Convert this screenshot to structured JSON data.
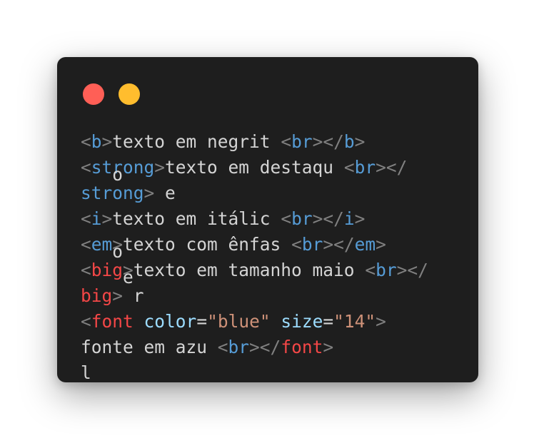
{
  "window": {
    "controls": [
      {
        "name": "close",
        "color": "#ff5f56"
      },
      {
        "name": "minimize",
        "color": "#ffbd2e"
      }
    ]
  },
  "theme": {
    "background": "#1e1e1e",
    "bracket": "#808080",
    "tag_blue": "#569cd6",
    "tag_red": "#f44747",
    "attr": "#9cdcfe",
    "string": "#ce9178",
    "text": "#d4d4d4"
  },
  "code_lines": [
    {
      "tokens": [
        {
          "t": "<",
          "k": "bracket"
        },
        {
          "t": "b",
          "k": "tag_blue"
        },
        {
          "t": ">",
          "k": "bracket"
        },
        {
          "t": "texto em negrit ",
          "k": "text"
        },
        {
          "t": "<",
          "k": "bracket"
        },
        {
          "t": "br",
          "k": "tag_blue"
        },
        {
          "t": "></",
          "k": "bracket"
        },
        {
          "t": "b",
          "k": "tag_blue"
        },
        {
          "t": ">",
          "k": "bracket"
        }
      ]
    },
    {
      "tokens": [
        {
          "t": "<",
          "k": "bracket"
        },
        {
          "t": "strong",
          "k": "tag_blue"
        },
        {
          "t": ">",
          "k": "bracket"
        },
        {
          "t": "texto em destaqu ",
          "k": "text"
        },
        {
          "t": "<",
          "k": "bracket"
        },
        {
          "t": "br",
          "k": "tag_blue"
        },
        {
          "t": "></",
          "k": "bracket"
        }
      ],
      "drop": {
        "t": "o",
        "col": 3
      }
    },
    {
      "tokens": [
        {
          "t": "strong",
          "k": "tag_blue"
        },
        {
          "t": ">",
          "k": "bracket"
        },
        {
          "t": " e",
          "k": "text"
        }
      ]
    },
    {
      "tokens": [
        {
          "t": "<",
          "k": "bracket"
        },
        {
          "t": "i",
          "k": "tag_blue"
        },
        {
          "t": ">",
          "k": "bracket"
        },
        {
          "t": "texto em itálic ",
          "k": "text"
        },
        {
          "t": "<",
          "k": "bracket"
        },
        {
          "t": "br",
          "k": "tag_blue"
        },
        {
          "t": "></",
          "k": "bracket"
        },
        {
          "t": "i",
          "k": "tag_blue"
        },
        {
          "t": ">",
          "k": "bracket"
        }
      ]
    },
    {
      "tokens": [
        {
          "t": "<",
          "k": "bracket"
        },
        {
          "t": "em",
          "k": "tag_blue"
        },
        {
          "t": ">",
          "k": "bracket"
        },
        {
          "t": "texto com ênfas ",
          "k": "text"
        },
        {
          "t": "<",
          "k": "bracket"
        },
        {
          "t": "br",
          "k": "tag_blue"
        },
        {
          "t": "></",
          "k": "bracket"
        },
        {
          "t": "em",
          "k": "tag_blue"
        },
        {
          "t": ">",
          "k": "bracket"
        }
      ],
      "drop": {
        "t": "o",
        "col": 3
      }
    },
    {
      "tokens": [
        {
          "t": "<",
          "k": "bracket"
        },
        {
          "t": "big",
          "k": "tag_red"
        },
        {
          "t": ">",
          "k": "bracket"
        },
        {
          "t": "texto em tamanho maio ",
          "k": "text"
        },
        {
          "t": "<",
          "k": "bracket"
        },
        {
          "t": "br",
          "k": "tag_blue"
        },
        {
          "t": "></",
          "k": "bracket"
        }
      ],
      "drop": {
        "t": "e",
        "col": 4
      }
    },
    {
      "tokens": [
        {
          "t": "big",
          "k": "tag_red"
        },
        {
          "t": ">",
          "k": "bracket"
        },
        {
          "t": " r",
          "k": "text"
        }
      ]
    },
    {
      "tokens": [
        {
          "t": "<",
          "k": "bracket"
        },
        {
          "t": "font",
          "k": "tag_red"
        },
        {
          "t": " ",
          "k": "text"
        },
        {
          "t": "color",
          "k": "attr"
        },
        {
          "t": "=",
          "k": "text"
        },
        {
          "t": "\"blue\"",
          "k": "string"
        },
        {
          "t": " ",
          "k": "text"
        },
        {
          "t": "size",
          "k": "attr"
        },
        {
          "t": "=",
          "k": "text"
        },
        {
          "t": "\"14\"",
          "k": "string"
        },
        {
          "t": ">",
          "k": "bracket"
        }
      ]
    },
    {
      "tokens": [
        {
          "t": "fonte em azu ",
          "k": "text"
        },
        {
          "t": "<",
          "k": "bracket"
        },
        {
          "t": "br",
          "k": "tag_blue"
        },
        {
          "t": "></",
          "k": "bracket"
        },
        {
          "t": "font",
          "k": "tag_red"
        },
        {
          "t": ">",
          "k": "bracket"
        }
      ]
    },
    {
      "tokens": [
        {
          "t": "l",
          "k": "text"
        }
      ]
    }
  ]
}
